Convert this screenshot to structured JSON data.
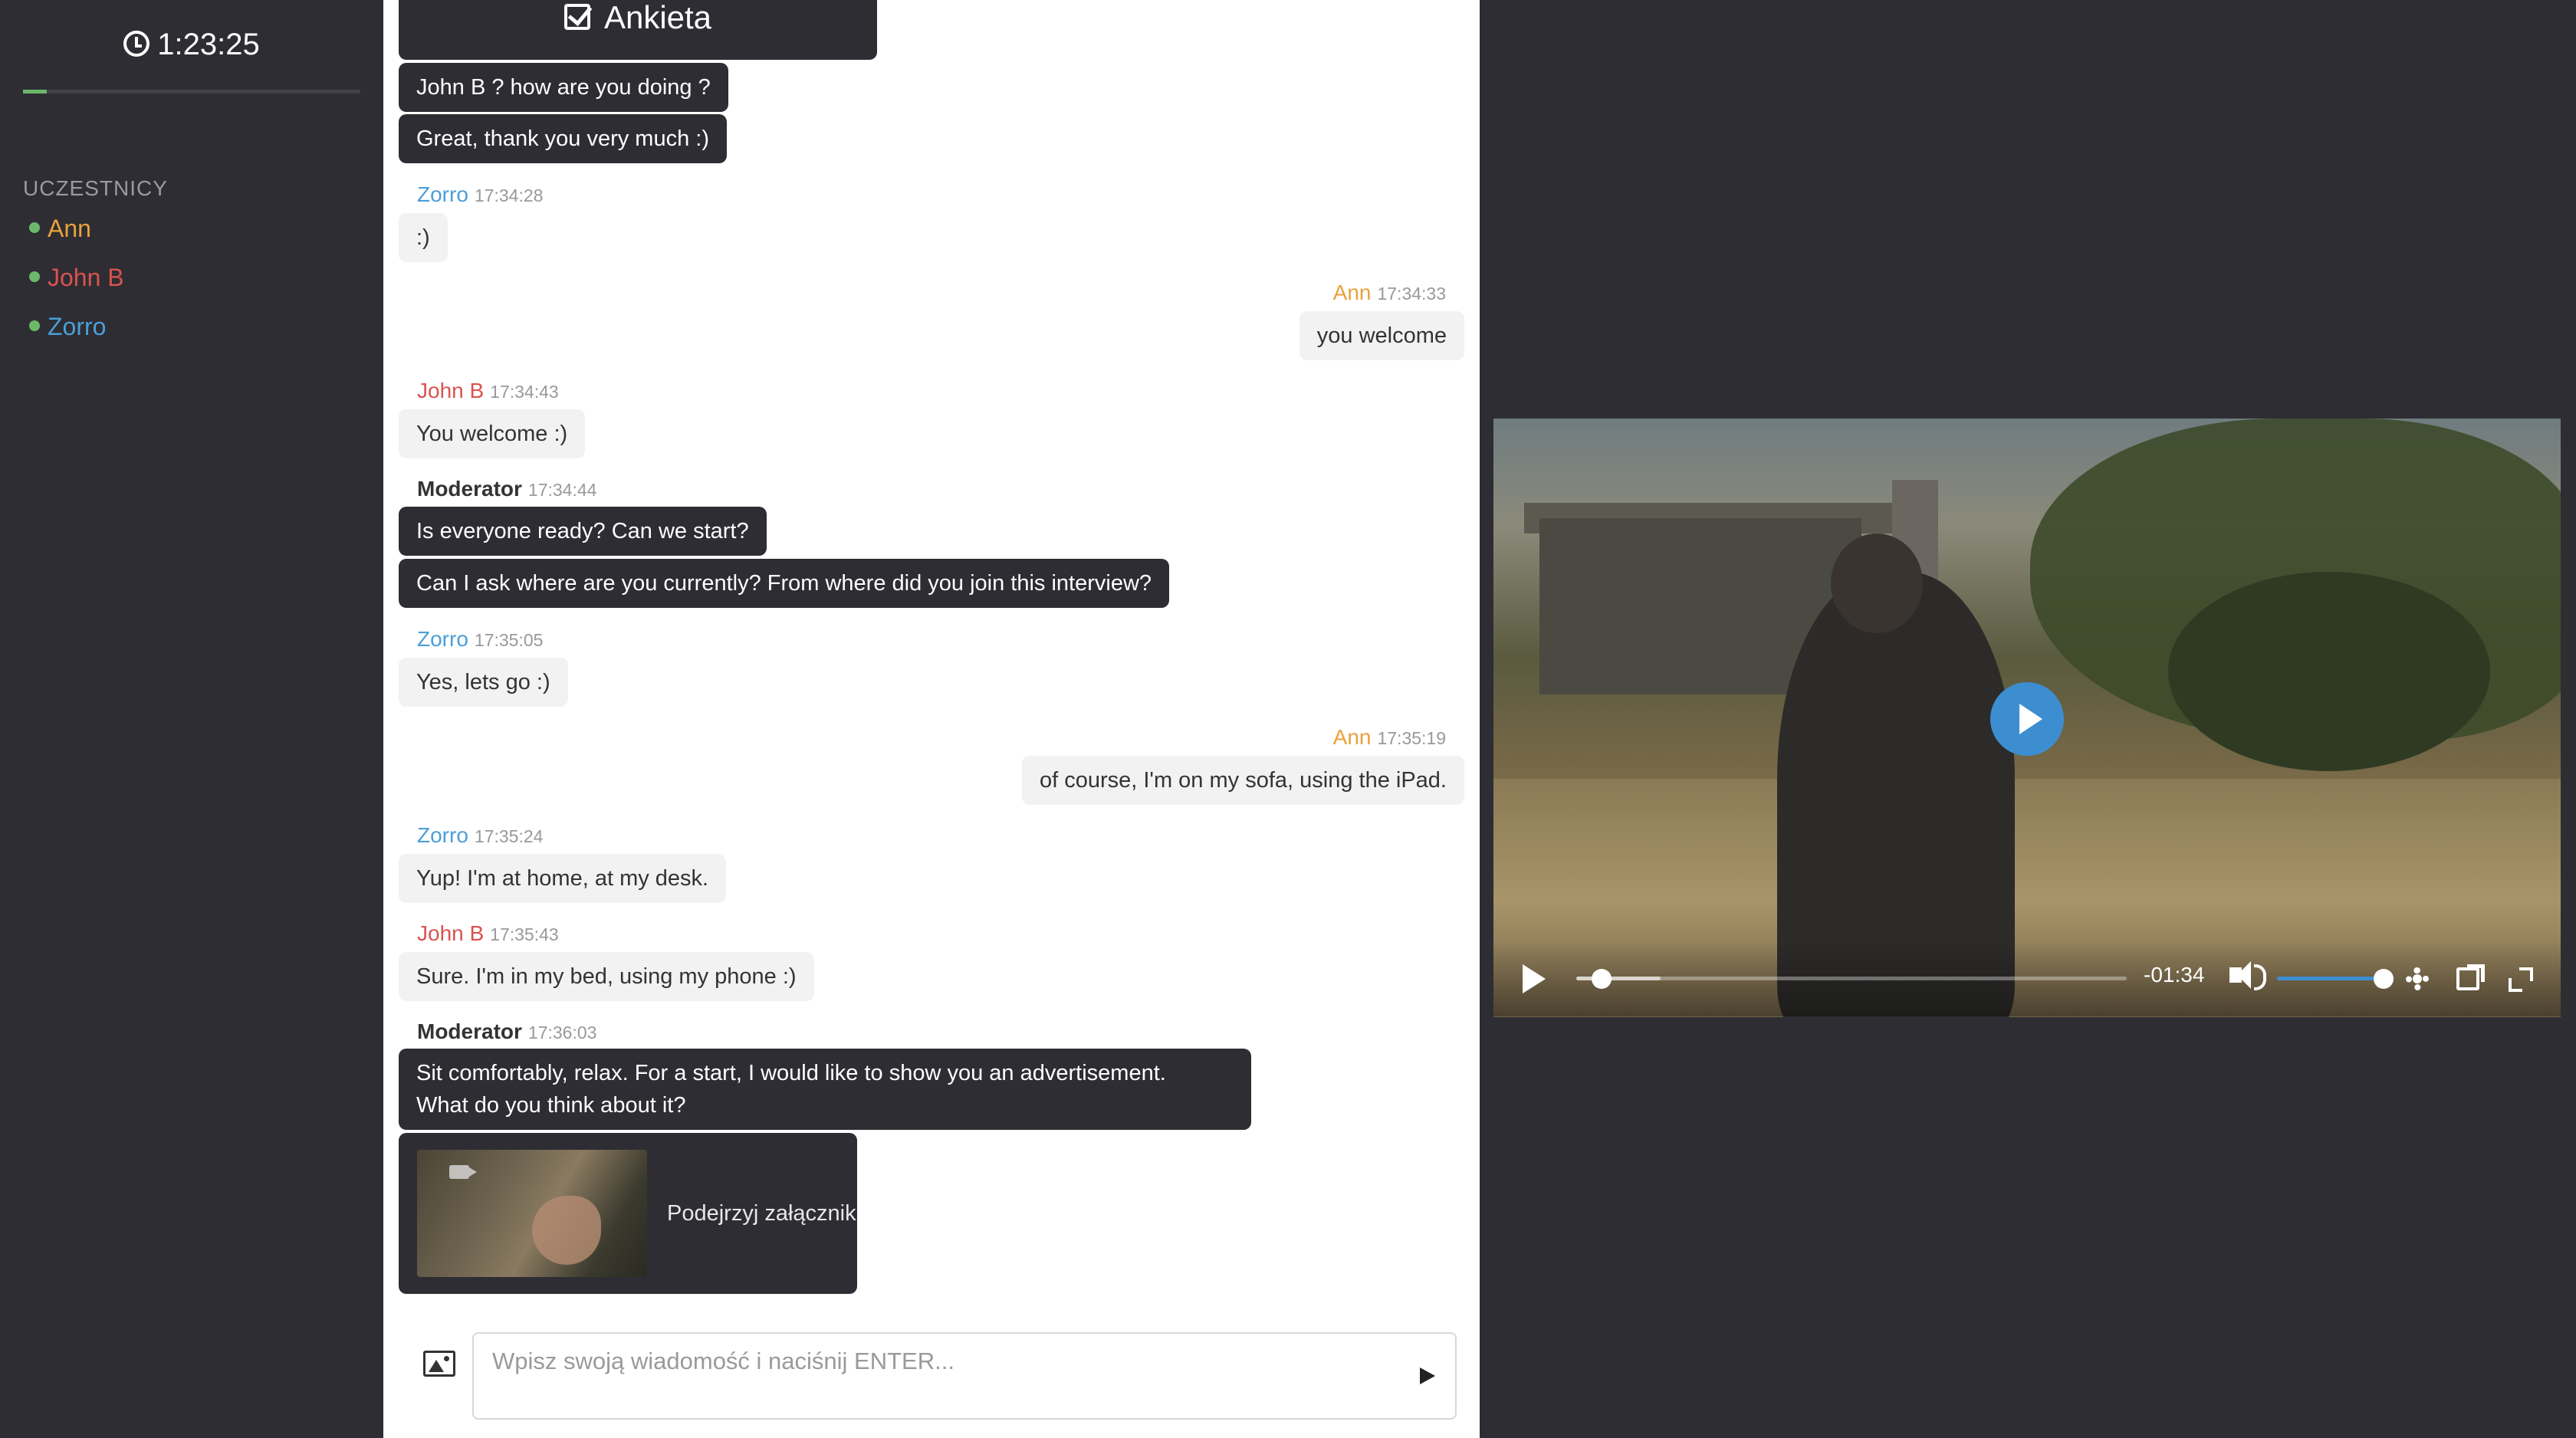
{
  "sidebar": {
    "timer": "1:23:25",
    "session_progress": 0.07,
    "participants_title": "UCZESTNICY",
    "participants": [
      {
        "name": "Ann",
        "color": "#e8a23b"
      },
      {
        "name": "John B",
        "color": "#d9534f"
      },
      {
        "name": "Zorro",
        "color": "#4a9fd8"
      }
    ]
  },
  "chat": {
    "survey_label": "Ankieta",
    "messages": [
      {
        "text": "John B ? how are you doing ?"
      },
      {
        "text": "Great, thank you very much :)"
      },
      {
        "author": "Zorro",
        "time": "17:34:28",
        "text": ":)"
      },
      {
        "author": "Ann",
        "time": "17:34:33",
        "text": "you welcome"
      },
      {
        "author": "John B",
        "time": "17:34:43",
        "text": "You welcome :)"
      },
      {
        "author": "Moderator",
        "time": "17:34:44",
        "text": "Is everyone ready? Can we start?"
      },
      {
        "text": "Can I ask where are you currently? From where did you join this interview?"
      },
      {
        "author": "Zorro",
        "time": "17:35:05",
        "text": "Yes, lets go :)"
      },
      {
        "author": "Ann",
        "time": "17:35:19",
        "text": "of course, I'm on my sofa, using the iPad."
      },
      {
        "author": "Zorro",
        "time": "17:35:24",
        "text": "Yup! I'm at home, at my desk."
      },
      {
        "author": "John B",
        "time": "17:35:43",
        "text": "Sure. I'm in my bed, using my phone :)"
      },
      {
        "author": "Moderator",
        "time": "17:36:03",
        "text_line1": "Sit comfortably, relax. For a start, I would like to show you an advertisement.",
        "text_line2": "What do you think about it?"
      }
    ],
    "attachment_label": "Podejrzyj załącznik",
    "input_placeholder": "Wpisz swoją wiadomość i naciśnij ENTER..."
  },
  "video": {
    "time_remaining": "-01:34",
    "playback_progress": 0.03,
    "volume": 1.0,
    "accent_color": "#3d8ed0"
  }
}
